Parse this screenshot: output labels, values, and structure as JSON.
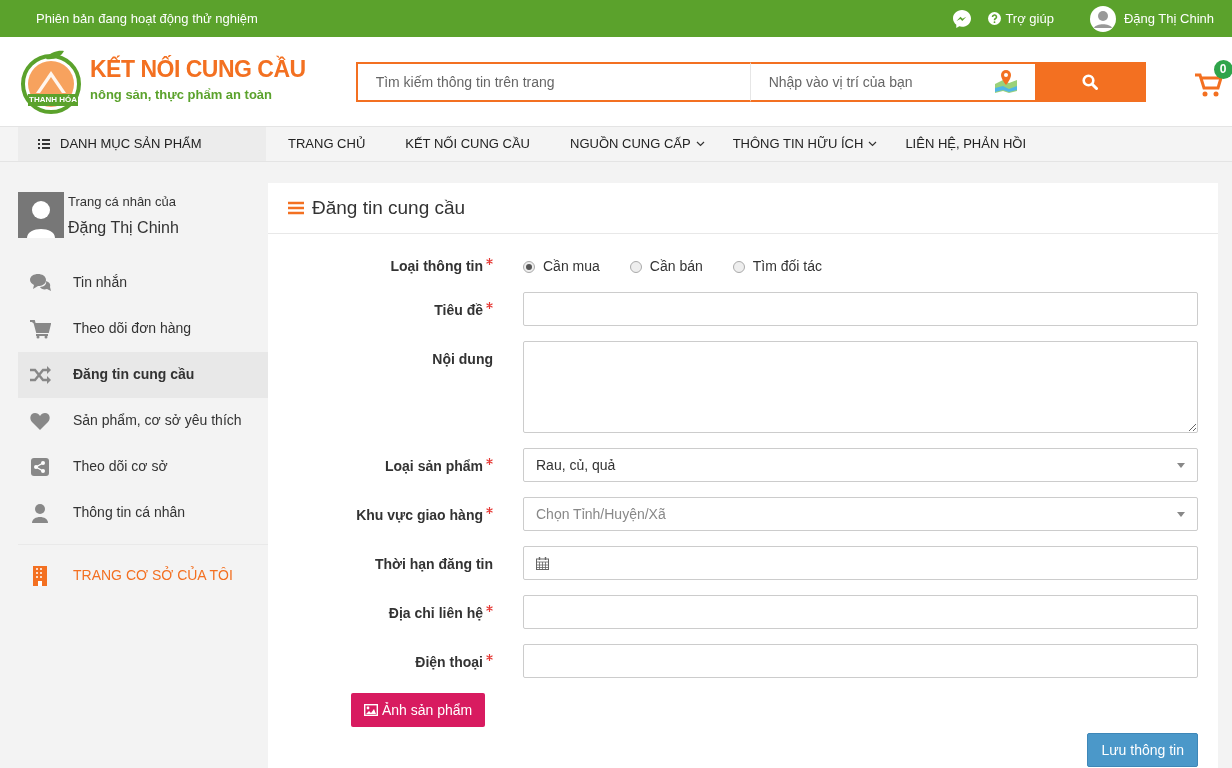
{
  "top_bar": {
    "notice": "Phiên bản đang hoạt động thử nghiệm",
    "help": "Trợ giúp",
    "user_name": "Đặng Thị Chinh"
  },
  "header": {
    "logo": {
      "title": "KẾT NỐI CUNG CẦU",
      "tagline": "nông sản, thực phẩm an toàn",
      "badge": "THANH HÓA"
    },
    "search": {
      "placeholder": "Tìm kiếm thông tin trên trang"
    },
    "location": {
      "placeholder": "Nhập vào vị trí của bạn"
    },
    "cart_count": "0"
  },
  "nav": {
    "category": "DANH MỤC SẢN PHẨM",
    "items": [
      {
        "label": "TRANG CHỦ",
        "dropdown": false
      },
      {
        "label": "KẾT NỐI CUNG CẦU",
        "dropdown": false
      },
      {
        "label": "NGUỒN CUNG CẤP",
        "dropdown": true
      },
      {
        "label": "THÔNG TIN HỮU ÍCH",
        "dropdown": true
      },
      {
        "label": "LIÊN HỆ, PHẢN HỒI",
        "dropdown": false
      }
    ]
  },
  "sidebar": {
    "profile_caption": "Trang cá nhân của",
    "profile_name": "Đặng Thị Chinh",
    "items": [
      {
        "label": "Tin nhắn",
        "selected": false
      },
      {
        "label": "Theo dõi đơn hàng",
        "selected": false
      },
      {
        "label": "Đăng tin cung cầu",
        "selected": true
      },
      {
        "label": "Sản phẩm, cơ sở yêu thích",
        "selected": false
      },
      {
        "label": "Theo dõi cơ sở",
        "selected": false
      },
      {
        "label": "Thông tin cá nhân",
        "selected": false
      }
    ],
    "store_link": "TRANG CƠ SỞ CỦA TÔI"
  },
  "form": {
    "title": "Đăng tin cung cầu",
    "fields": [
      {
        "kind": "radio",
        "label": "Loại thông tin",
        "required": true,
        "options": [
          {
            "label": "Cần mua",
            "selected": true
          },
          {
            "label": "Cần bán",
            "selected": false
          },
          {
            "label": "Tìm đối tác",
            "selected": false
          }
        ]
      },
      {
        "kind": "text",
        "label": "Tiêu đề",
        "required": true
      },
      {
        "kind": "textarea",
        "label": "Nội dung",
        "required": false
      },
      {
        "kind": "select",
        "label": "Loại sản phẩm",
        "required": true,
        "value": "Rau, củ, quả"
      },
      {
        "kind": "select",
        "label": "Khu vực giao hàng",
        "required": true,
        "placeholder": "Chọn Tỉnh/Huyện/Xã"
      },
      {
        "kind": "date",
        "label": "Thời hạn đăng tin",
        "required": false
      },
      {
        "kind": "text",
        "label": "Địa chỉ liên hệ",
        "required": true
      },
      {
        "kind": "text",
        "label": "Điện thoại",
        "required": true
      }
    ],
    "photo_button": "Ảnh sản phẩm",
    "save_button": "Lưu thông tin"
  }
}
